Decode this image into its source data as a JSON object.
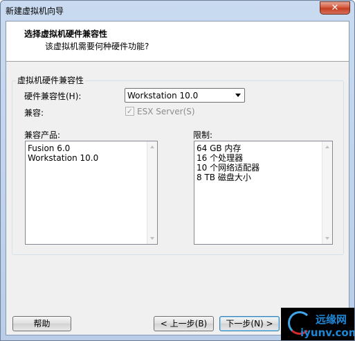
{
  "window": {
    "title": "新建虚拟机向导",
    "close_glyph": "✕"
  },
  "header": {
    "title": "选择虚拟机硬件兼容性",
    "subtitle": "该虚拟机需要何种硬件功能?"
  },
  "group": {
    "label": "虚拟机硬件兼容性",
    "hw_label": "硬件兼容性(H):",
    "hw_selected": "Workstation 10.0",
    "compat_label": "兼容:",
    "esx_label": "ESX Server(S)",
    "esx_checked": true
  },
  "compatible_products": {
    "label": "兼容产品:",
    "items": [
      "Fusion 6.0",
      "Workstation 10.0"
    ]
  },
  "limits": {
    "label": "限制:",
    "items": [
      "64 GB 内存",
      "16 个处理器",
      "10 个网络适配器",
      "8 TB 磁盘大小"
    ]
  },
  "buttons": {
    "help": "帮助",
    "back": "< 上一步(B)",
    "next": "下一步(N) >"
  },
  "watermark": {
    "top": "远缘网",
    "bottom": "iyunv.com"
  }
}
